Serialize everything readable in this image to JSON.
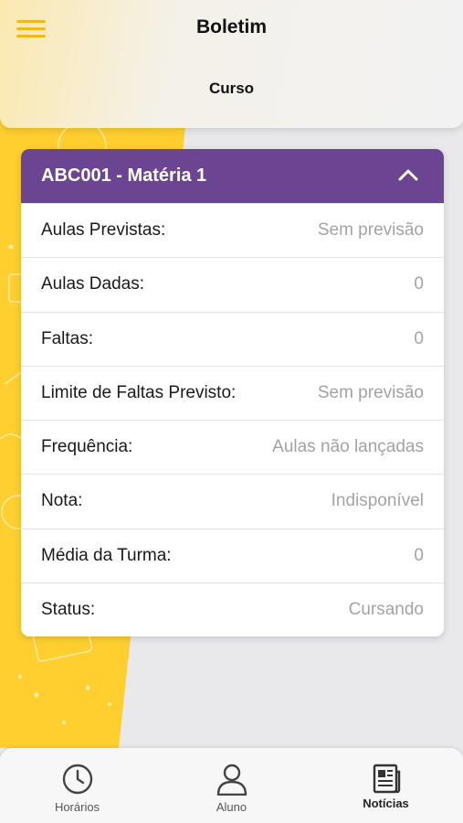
{
  "header": {
    "title": "Boletim",
    "subtitle": "Curso"
  },
  "card": {
    "title": "ABC001 - Matéria 1",
    "rows": [
      {
        "label": "Aulas Previstas:",
        "value": "Sem previsão"
      },
      {
        "label": "Aulas Dadas:",
        "value": "0"
      },
      {
        "label": "Faltas:",
        "value": "0"
      },
      {
        "label": "Limite de Faltas Previsto:",
        "value": "Sem previsão"
      },
      {
        "label": "Frequência:",
        "value": "Aulas não lançadas"
      },
      {
        "label": "Nota:",
        "value": "Indisponível"
      },
      {
        "label": "Média da Turma:",
        "value": "0"
      },
      {
        "label": "Status:",
        "value": "Cursando"
      }
    ]
  },
  "tabbar": {
    "items": [
      {
        "label": "Horários",
        "icon": "clock-icon"
      },
      {
        "label": "Aluno",
        "icon": "user-icon"
      },
      {
        "label": "Notícias",
        "icon": "newspaper-icon"
      }
    ]
  },
  "colors": {
    "accent_yellow": "#f2b81a",
    "background_yellow": "#ffd02e",
    "card_header_purple": "#6b4592",
    "value_gray": "#a3a3a3"
  }
}
